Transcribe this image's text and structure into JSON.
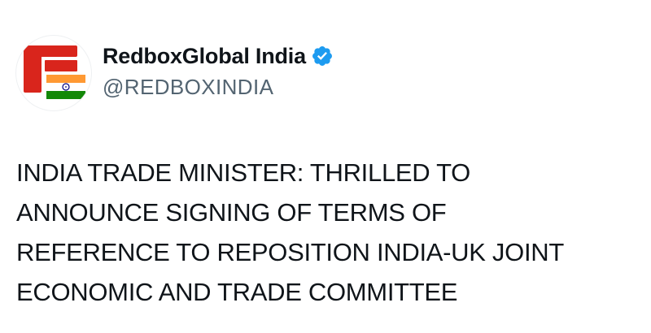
{
  "author": {
    "display_name": "RedboxGlobal India",
    "handle": "@REDBOXINDIA",
    "verified": true,
    "avatar_icon": "redbox-india-logo-icon",
    "verified_icon": "verified-badge-icon"
  },
  "tweet": {
    "lines": [
      "INDIA TRADE MINISTER: THRILLED TO",
      "ANNOUNCE SIGNING OF TERMS OF",
      "REFERENCE TO REPOSITION INDIA-UK JOINT",
      "ECONOMIC AND TRADE COMMITTEE"
    ]
  },
  "colors": {
    "logo_red": "#d9251c",
    "flag_saffron": "#ff9933",
    "flag_green": "#138808",
    "flag_chakra": "#000080",
    "verified_blue": "#1d9bf0",
    "handle_gray": "#536471",
    "text": "#0f1419"
  }
}
